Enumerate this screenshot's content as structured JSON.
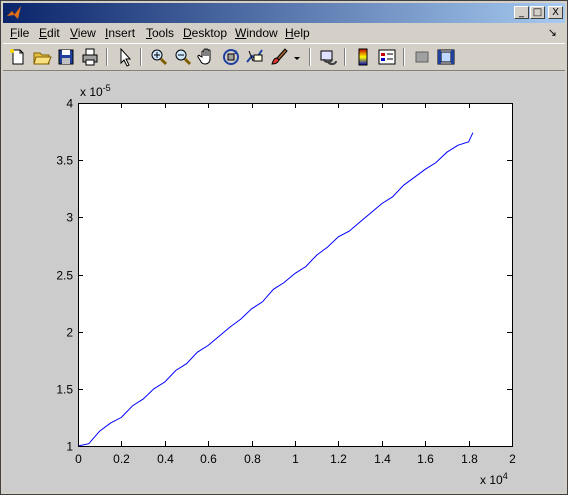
{
  "window": {
    "title": "",
    "controls": {
      "minimize": "_",
      "maximize": "□",
      "close": "X"
    }
  },
  "menu": {
    "items": [
      {
        "label": "File",
        "u": "F",
        "rest": "ile"
      },
      {
        "label": "Edit",
        "u": "E",
        "rest": "dit"
      },
      {
        "label": "View",
        "u": "V",
        "rest": "iew"
      },
      {
        "label": "Insert",
        "u": "I",
        "rest": "nsert"
      },
      {
        "label": "Tools",
        "u": "T",
        "rest": "ools"
      },
      {
        "label": "Desktop",
        "u": "D",
        "rest": "esktop"
      },
      {
        "label": "Window",
        "u": "W",
        "rest": "indow"
      },
      {
        "label": "Help",
        "u": "H",
        "rest": "elp"
      }
    ],
    "dock_arrow": "↘"
  },
  "toolbar": {
    "icons": [
      "new-figure-icon",
      "open-file-icon",
      "save-icon",
      "print-icon",
      "edit-plot-arrow-icon",
      "zoom-in-icon",
      "zoom-out-icon",
      "pan-hand-icon",
      "rotate-3d-icon",
      "data-cursor-icon",
      "brush-icon",
      "brush-dropdown-icon",
      "link-plot-icon",
      "colorbar-icon",
      "legend-icon",
      "hide-plot-tools-icon",
      "show-plot-tools-icon"
    ]
  },
  "chart_data": {
    "type": "line",
    "title": "",
    "xlabel": "",
    "ylabel": "",
    "xlim": [
      0,
      2
    ],
    "ylim": [
      1,
      4
    ],
    "x_multiplier": "x 10",
    "x_multiplier_exp": "4",
    "y_multiplier": "x 10",
    "y_multiplier_exp": "-5",
    "x_ticks": [
      "0",
      "0.2",
      "0.4",
      "0.6",
      "0.8",
      "1",
      "1.2",
      "1.4",
      "1.6",
      "1.8",
      "2"
    ],
    "y_ticks": [
      "1",
      "1.5",
      "2",
      "2.5",
      "3",
      "3.5",
      "4"
    ],
    "line_color": "#0000ff",
    "grid": false,
    "series": [
      {
        "x": [
          0.0,
          0.05,
          0.1,
          0.15,
          0.2,
          0.25,
          0.3,
          0.35,
          0.4,
          0.45,
          0.5,
          0.55,
          0.6,
          0.65,
          0.7,
          0.75,
          0.8,
          0.85,
          0.9,
          0.95,
          1.0,
          1.05,
          1.1,
          1.15,
          1.2,
          1.25,
          1.3,
          1.35,
          1.4,
          1.45,
          1.5,
          1.55,
          1.6,
          1.65,
          1.7,
          1.75,
          1.8,
          1.82
        ],
        "y": [
          1.0,
          1.02,
          1.13,
          1.2,
          1.25,
          1.35,
          1.41,
          1.5,
          1.56,
          1.66,
          1.72,
          1.82,
          1.88,
          1.96,
          2.04,
          2.11,
          2.2,
          2.26,
          2.37,
          2.43,
          2.51,
          2.57,
          2.67,
          2.74,
          2.83,
          2.88,
          2.96,
          3.04,
          3.12,
          3.18,
          3.28,
          3.35,
          3.42,
          3.48,
          3.57,
          3.63,
          3.66,
          3.74
        ]
      }
    ]
  }
}
